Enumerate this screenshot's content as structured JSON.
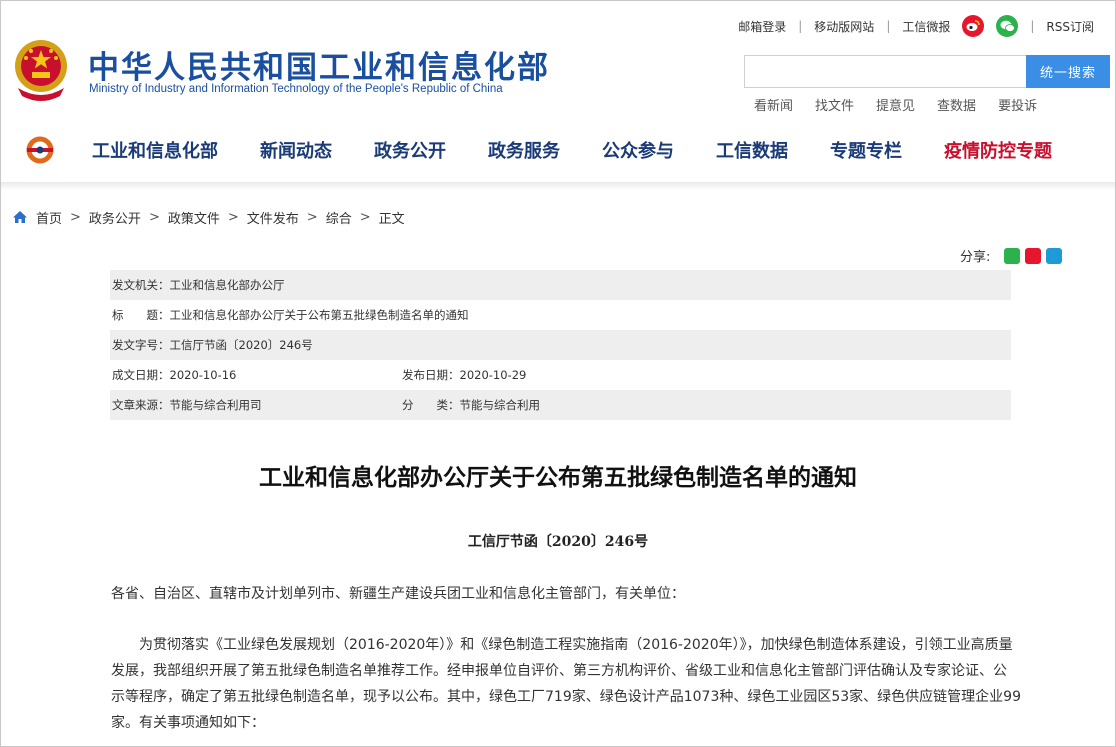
{
  "header": {
    "title": "中华人民共和国工业和信息化部",
    "subtitle": "Ministry of Industry and Information Technology of the People's Republic of China",
    "top_links": [
      "邮箱登录",
      "移动版网站",
      "工信微报",
      "RSS订阅"
    ],
    "search_button": "统一搜索",
    "search_placeholder": "",
    "quick_links": [
      "看新闻",
      "找文件",
      "提意见",
      "查数据",
      "要投诉"
    ]
  },
  "nav": {
    "items": [
      "工业和信息化部",
      "新闻动态",
      "政务公开",
      "政务服务",
      "公众参与",
      "工信数据",
      "专题专栏",
      "疫情防控专题"
    ]
  },
  "breadcrumb": [
    "首页",
    "政务公开",
    "政策文件",
    "文件发布",
    "综合",
    "正文"
  ],
  "share_label": "分享:",
  "meta": {
    "issuer": "发文机关：工业和信息化部办公厅",
    "title": "标　　题：工业和信息化部办公厅关于公布第五批绿色制造名单的通知",
    "doc_no": "发文字号：工信厅节函〔2020〕246号",
    "created": "成文日期：2020-10-16",
    "published": "发布日期：2020-10-29",
    "source": "文章来源：节能与综合利用司",
    "category": "分　　类：节能与综合利用"
  },
  "article": {
    "title": "工业和信息化部办公厅关于公布第五批绿色制造名单的通知",
    "doc_no": "工信厅节函〔2020〕246号",
    "salutation": "各省、自治区、直辖市及计划单列市、新疆生产建设兵团工业和信息化主管部门，有关单位：",
    "paragraph_lines": [
      "为贯彻落实《工业绿色发展规划（2016-2020年）》和《绿色制造工程实施指南（2016-2020年）》，加快绿色制造体系建设，引领工业高质量",
      "发展，我部组织开展了第五批绿色制造名单推荐工作。经申报单位自评价、第三方机构评价、省级工业和信息化主管部门评估确认及专家论证、公",
      "示等程序，确定了第五批绿色制造名单，现予以公布。其中，绿色工厂719家、绿色设计产品1073种、绿色工业园区53家、绿色供应链管理企业99",
      "家。有关事项通知如下："
    ]
  },
  "colors": {
    "brand_blue": "#1a4fa0",
    "nav_blue": "#1a3a78",
    "highlight_red": "#c8102e",
    "search_blue": "#3a8ee6"
  },
  "icons": [
    "national-emblem-icon",
    "weibo-icon",
    "wechat-icon",
    "miit-logo-icon",
    "home-icon",
    "share-wechat-icon",
    "share-weibo-icon",
    "share-qq-icon"
  ]
}
